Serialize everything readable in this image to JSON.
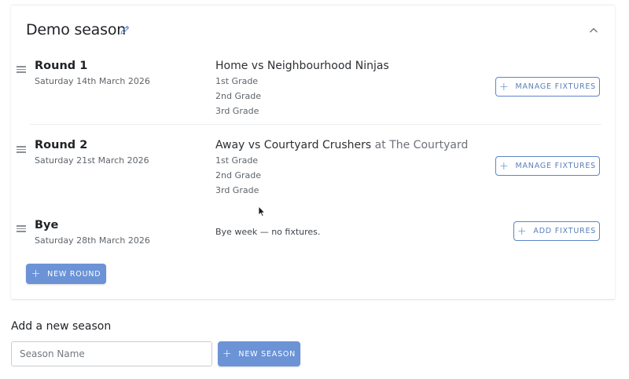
{
  "season": {
    "title": "Demo season",
    "rounds": [
      {
        "name": "Round 1",
        "date": "Saturday 14th March 2026",
        "opponent": "Home vs Neighbourhood Ninjas",
        "venue": "",
        "grades": [
          "1st Grade",
          "2nd Grade",
          "3rd Grade"
        ],
        "action_label": "MANAGE FIXTURES"
      },
      {
        "name": "Round 2",
        "date": "Saturday 21st March 2026",
        "opponent": "Away vs Courtyard Crushers",
        "venue": " at The Courtyard",
        "grades": [
          "1st Grade",
          "2nd Grade",
          "3rd Grade"
        ],
        "action_label": "MANAGE FIXTURES"
      },
      {
        "name": "Bye",
        "date": "Saturday 28th March 2026",
        "note": "Bye week — no fixtures.",
        "action_label": "ADD FIXTURES"
      }
    ],
    "new_round_label": "NEW ROUND"
  },
  "add_season": {
    "heading": "Add a new season",
    "input_placeholder": "Season Name",
    "input_value": "",
    "button_label": "NEW SEASON"
  },
  "icons": {
    "edit": "pencil-icon",
    "collapse": "chevron-up-icon",
    "drag": "drag-handle-icon",
    "plus": "plus-icon",
    "cursor": "mouse-cursor-icon"
  },
  "colors": {
    "accent": "#6b93d6",
    "accent_border": "#5b86c7",
    "text": "#1f2226",
    "muted": "#5f656b"
  }
}
